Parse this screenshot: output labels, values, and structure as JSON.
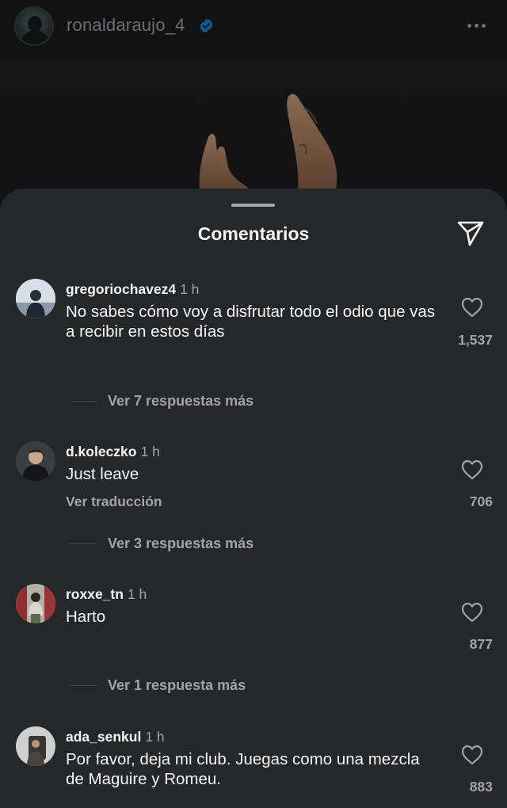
{
  "post": {
    "username": "ronaldaraujo_4",
    "verified": true,
    "menu_icon": "more-horizontal-icon"
  },
  "sheet": {
    "title": "Comentarios",
    "share_icon": "paper-plane-icon"
  },
  "comments": [
    {
      "username": "gregoriochavez4",
      "time": "1 h",
      "text": "No sabes cómo voy a disfrutar todo el odio que vas a recibir en estos días",
      "likes": "1,537",
      "translate": "",
      "replies": "Ver 7 respuestas más"
    },
    {
      "username": "d.koleczko",
      "time": "1 h",
      "text": "Just leave",
      "likes": "706",
      "translate": "Ver traducción",
      "replies": "Ver 3 respuestas más"
    },
    {
      "username": "roxxe_tn",
      "time": "1 h",
      "text": "Harto",
      "likes": "877",
      "translate": "",
      "replies": "Ver 1 respuesta más"
    },
    {
      "username": "ada_senkul",
      "time": "1 h",
      "text": "Por favor, deja mi club. Juegas como una mezcla de Maguire y Romeu.",
      "likes": "883",
      "translate": "",
      "replies": ""
    }
  ],
  "colors": {
    "sheet_bg": "#262729",
    "primary_text": "#f5f5f5",
    "secondary_text": "#a3a3a7",
    "verified_blue": "#0095f6"
  }
}
